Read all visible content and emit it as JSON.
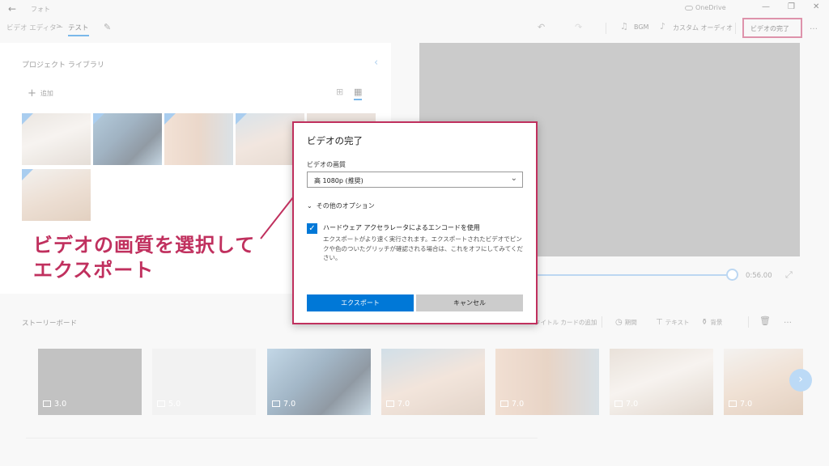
{
  "titlebar": {
    "back_glyph": "←",
    "app_title": "フォト",
    "onedrive": "OneDrive",
    "minimize_glyph": "—",
    "maximize_glyph": "❐",
    "close_glyph": "✕"
  },
  "toolbar": {
    "crumb_editor": "ビデオ エディター",
    "crumb_separator": ">",
    "crumb_project": "テスト",
    "undo_glyph": "↶",
    "redo_glyph": "↷",
    "bgm": "BGM",
    "custom_audio": "カスタム オーディオ",
    "finish_video": "ビデオの完了",
    "more": "…"
  },
  "library": {
    "title": "プロジェクト ライブラリ",
    "collapse_glyph": "‹",
    "add_label": "追加",
    "add_glyph": "+"
  },
  "preview": {
    "time": "0:56.00",
    "expand_glyph": "⤢"
  },
  "storyboard": {
    "title": "ストーリーボード",
    "tools": {
      "title_card": "タイトル カードの追加",
      "duration": "期間",
      "text": "テキスト",
      "background": "背景"
    },
    "more": "…",
    "next_glyph": "›",
    "clips": [
      {
        "duration": "3.0"
      },
      {
        "duration": "5.0"
      },
      {
        "duration": "7.0"
      },
      {
        "duration": "7.0"
      },
      {
        "duration": "7.0"
      },
      {
        "duration": "7.0"
      },
      {
        "duration": "7.0"
      }
    ]
  },
  "dialog": {
    "title": "ビデオの完了",
    "quality_label": "ビデオの画質",
    "quality_value": "高 1080p (推奨)",
    "more_options": "その他のオプション",
    "hw_checkbox_label": "ハードウェア アクセラレータによるエンコードを使用",
    "hw_checked": true,
    "hw_description": "エクスポートがより速く実行されます。エクスポートされたビデオでピンクや色のついたグリッチが確認される場合は、これをオフにしてみてください。",
    "export_button": "エクスポート",
    "cancel_button": "キャンセル"
  },
  "annotation": {
    "line1": "ビデオの画質を選択して",
    "line2": "エクスポート",
    "color": "#c0305e"
  },
  "colors": {
    "accent": "#0078d7",
    "highlight": "#c0305e"
  }
}
